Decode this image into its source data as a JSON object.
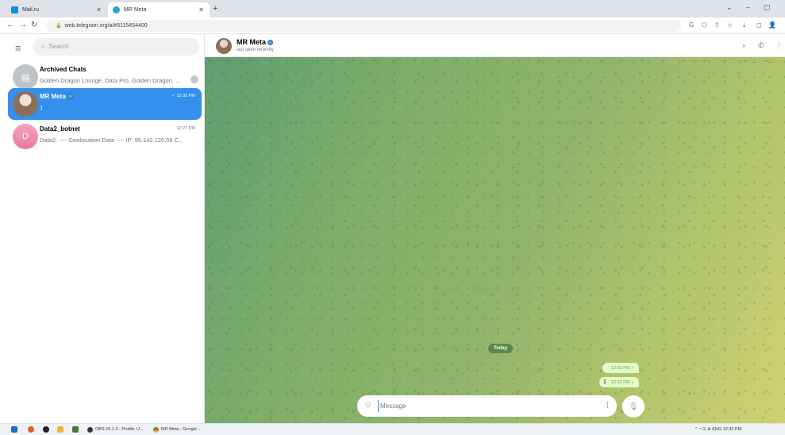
{
  "browser": {
    "tabs": [
      {
        "label": "Mail.ru",
        "favicon_color": "#168de2"
      },
      {
        "label": "MR Meta",
        "favicon_color": "#2aa3de"
      }
    ],
    "new_tab": "+",
    "window_controls": [
      "⌄",
      "–",
      "▢"
    ],
    "url": "web.telegram.org/a/#5115454400",
    "toolbar_icons": [
      "G",
      "⬡",
      "⇧",
      "☆",
      "⤓",
      "◻",
      "👤"
    ]
  },
  "sidebar": {
    "search_placeholder": "Search",
    "chats": [
      {
        "name": "Archived Chats",
        "preview": "Golden Dragon Lounge, Data Pro, Golden Dragon, ...",
        "time": "",
        "avatar_color": "#bfc4c8",
        "avatar_letter": "▤",
        "selected": false
      },
      {
        "name": "MR Meta",
        "preview": "1",
        "time": "✓ 12:32 PM",
        "avatar_color": "#8b6f5b",
        "avatar_letter": "",
        "selected": true
      },
      {
        "name": "Data2_botnet",
        "preview": "Data2: ---- Geolocation Data ---- IP: 95.142.120.56 C...",
        "time": "12:27 PM",
        "avatar_color": "#f08aac",
        "avatar_letter": "D",
        "selected": false
      }
    ]
  },
  "chat": {
    "title": "MR Meta",
    "status": "last seen recently",
    "date_label": "Today",
    "messages": [
      {
        "text": "",
        "time": "12:32 PM ✓"
      },
      {
        "text": "1",
        "time": "12:32 PM ✓"
      }
    ],
    "composer_placeholder": "Message"
  },
  "taskbar": {
    "apps": [
      {
        "label": "OBS 29.1.3 - Profile: U...",
        "color": "#333333"
      },
      {
        "label": "MR Meta - Google ...",
        "color": "#e8453c"
      }
    ],
    "tray": "^  ◔  ⊡  ⊕  ENG  12:32 PM"
  },
  "colors": {
    "accent": "#3390ec",
    "bubble": "#e2fdc6"
  }
}
